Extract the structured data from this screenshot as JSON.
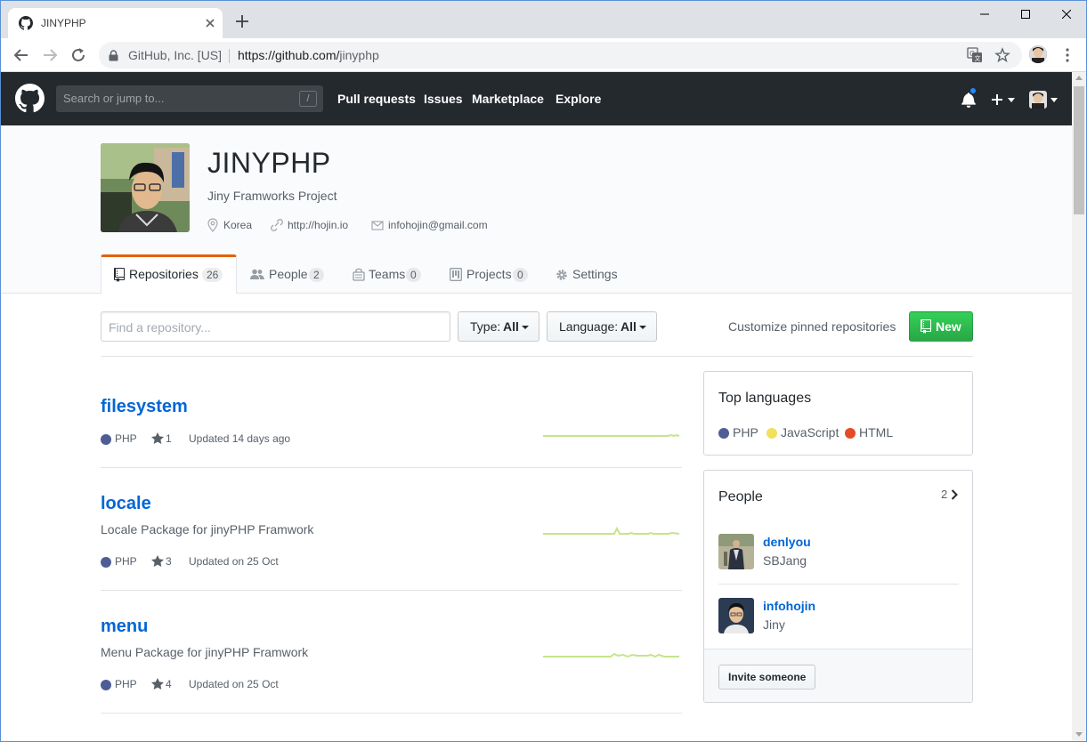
{
  "browser": {
    "tab_title": "JINYPHP",
    "url_org": "GitHub, Inc. [US]",
    "url_scheme_host": "https://github.com/",
    "url_path": "jinyphp"
  },
  "github": {
    "search_placeholder": "Search or jump to...",
    "search_shortcut": "/",
    "nav": [
      "Pull requests",
      "Issues",
      "Marketplace",
      "Explore"
    ]
  },
  "org": {
    "name": "JINYPHP",
    "description": "Jiny Framworks Project",
    "location": "Korea",
    "website": "http://hojin.io",
    "email": "infohojin@gmail.com",
    "tabs": [
      {
        "label": "Repositories",
        "count": "26",
        "icon": "repo-icon",
        "selected": true
      },
      {
        "label": "People",
        "count": "2",
        "icon": "people-icon"
      },
      {
        "label": "Teams",
        "count": "0",
        "icon": "teams-icon"
      },
      {
        "label": "Projects",
        "count": "0",
        "icon": "projects-icon"
      },
      {
        "label": "Settings",
        "count": null,
        "icon": "gear-icon"
      }
    ]
  },
  "filters": {
    "find_placeholder": "Find a repository...",
    "type_label": "Type:",
    "type_value": "All",
    "language_label": "Language:",
    "language_value": "All",
    "customize_label": "Customize pinned repositories",
    "new_label": "New"
  },
  "repos": [
    {
      "name": "filesystem",
      "description": "",
      "language": "PHP",
      "stars": "1",
      "updated": "Updated 14 days ago"
    },
    {
      "name": "locale",
      "description": "Locale Package for jinyPHP Framwork",
      "language": "PHP",
      "stars": "3",
      "updated": "Updated on 25 Oct"
    },
    {
      "name": "menu",
      "description": "Menu Package for jinyPHP Framwork",
      "language": "PHP",
      "stars": "4",
      "updated": "Updated on 25 Oct"
    }
  ],
  "sidebar": {
    "top_languages_title": "Top languages",
    "languages": [
      {
        "name": "PHP",
        "color": "#4F5D95"
      },
      {
        "name": "JavaScript",
        "color": "#f1e05a"
      },
      {
        "name": "HTML",
        "color": "#e34c26"
      }
    ],
    "people_title": "People",
    "people_count": "2",
    "people": [
      {
        "login": "denlyou",
        "name": "SBJang"
      },
      {
        "login": "infohojin",
        "name": "Jiny"
      }
    ],
    "invite_label": "Invite someone"
  },
  "colors": {
    "php": "#4F5D95",
    "link": "#0366d6",
    "header_bg": "#24292e",
    "new_button": "#28a745",
    "tab_accent": "#e36209",
    "sparkline": "#c6e48b"
  }
}
